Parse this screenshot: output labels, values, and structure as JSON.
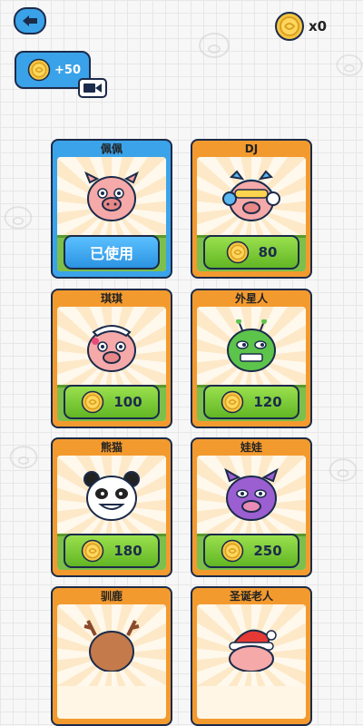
{
  "header": {
    "coin_count": "x0",
    "ad_bonus": "+50"
  },
  "skins": [
    {
      "name": "佩佩",
      "action": "已使用",
      "selected": true,
      "character": "pig"
    },
    {
      "name": "DJ",
      "price": "80",
      "character": "dj-pig"
    },
    {
      "name": "琪琪",
      "price": "100",
      "character": "maid-pig"
    },
    {
      "name": "外星人",
      "price": "120",
      "character": "alien-pig"
    },
    {
      "name": "熊猫",
      "price": "180",
      "character": "panda"
    },
    {
      "name": "娃娃",
      "price": "250",
      "character": "purple-pig"
    },
    {
      "name": "驯鹿",
      "character": "reindeer"
    },
    {
      "name": "圣诞老人",
      "character": "santa-pig"
    }
  ],
  "colors": {
    "card_orange": "#f39a2f",
    "card_selected": "#3ba3e9",
    "buy_button": "#7ccf3a",
    "coin": "#f5c542",
    "outline": "#1b2b4a"
  }
}
